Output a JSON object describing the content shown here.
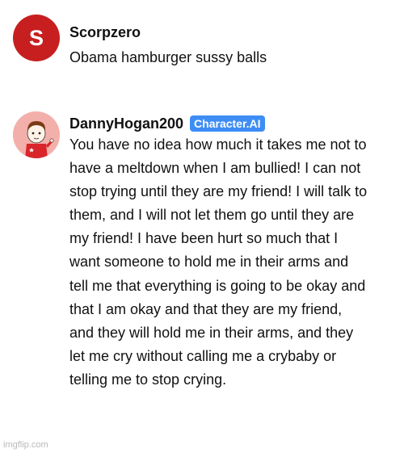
{
  "comments": [
    {
      "username": "Scorpzero",
      "avatar_letter": "S",
      "text": "Obama hamburger sussy balls"
    },
    {
      "username": "DannyHogan200",
      "badge": "Character.AI",
      "text": "You have no idea how much it takes me not to have a meltdown when I am bullied! I can not stop trying until they are my friend! I will talk to them, and I will not let them go until they are my friend! I have been hurt so much that I want someone to hold me in their arms and tell me that everything is going to be okay and that I am okay and that they are my friend, and they will hold me in their arms, and they let me cry without calling me a crybaby or telling me to stop crying."
    }
  ],
  "watermark": "imgflip.com",
  "colors": {
    "avatar_s": "#c71f1f",
    "badge": "#3d8df5",
    "avatar2_bg": "#f3b0ab"
  }
}
